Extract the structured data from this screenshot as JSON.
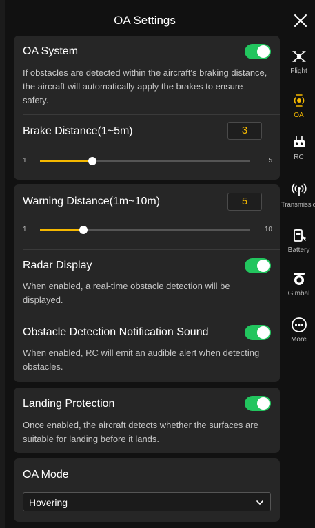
{
  "header": {
    "title": "OA Settings"
  },
  "oa_system": {
    "label": "OA System",
    "enabled": true,
    "description": " If obstacles are detected within the aircraft's braking distance, the aircraft will automatically apply the brakes to ensure safety."
  },
  "brake_distance": {
    "label": "Brake Distance(1~5m)",
    "value": "3",
    "min": "1",
    "max": "5",
    "fraction": 0.25
  },
  "warning_distance": {
    "label": "Warning Distance(1m~10m)",
    "value": "5",
    "min": "1",
    "max": "10",
    "fraction": 0.2
  },
  "radar_display": {
    "label": "Radar Display",
    "enabled": true,
    "description": "When enabled, a real-time obstacle detection will be displayed."
  },
  "notification_sound": {
    "label": "Obstacle Detection Notification Sound",
    "enabled": true,
    "description": "When enabled, RC will emit an audible alert when detecting obstacles."
  },
  "landing_protection": {
    "label": "Landing Protection",
    "enabled": true,
    "description": "Once enabled, the aircraft detects whether the surfaces are suitable for landing before it lands."
  },
  "oa_mode": {
    "label": "OA Mode",
    "selected": "Hovering"
  },
  "sidebar": {
    "items": [
      {
        "label": "Flight",
        "icon": "drone-icon"
      },
      {
        "label": "OA",
        "icon": "radar-icon",
        "active": true
      },
      {
        "label": "RC",
        "icon": "controller-icon"
      },
      {
        "label": "Transmission",
        "icon": "signal-icon"
      },
      {
        "label": "Battery",
        "icon": "battery-icon"
      },
      {
        "label": "Gimbal",
        "icon": "gimbal-icon"
      },
      {
        "label": "More",
        "icon": "more-icon"
      }
    ]
  },
  "colors": {
    "accent": "#f5b800",
    "toggle_on": "#22c55e",
    "card": "#262626",
    "background": "#111111"
  }
}
